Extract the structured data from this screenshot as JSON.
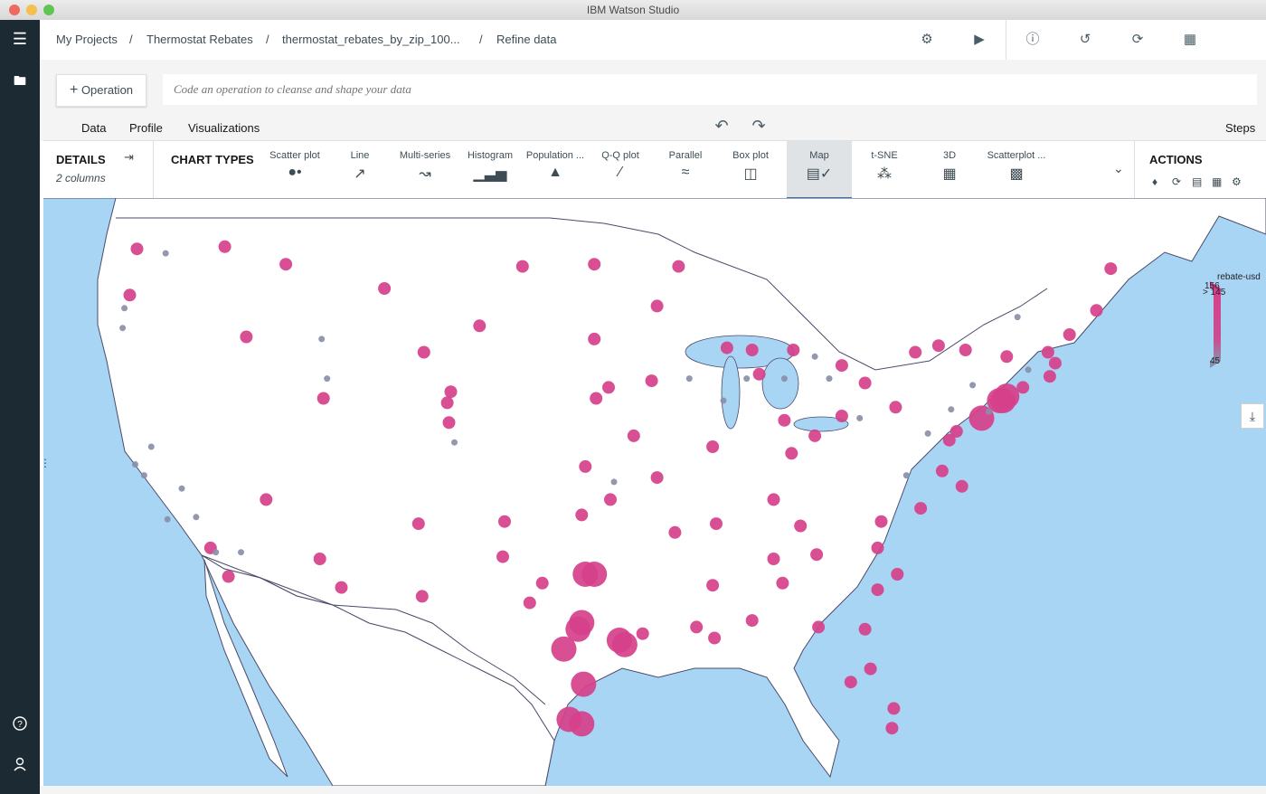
{
  "window": {
    "title": "IBM Watson Studio"
  },
  "breadcrumbs": [
    "My Projects",
    "Thermostat Rebates",
    "thermostat_rebates_by_zip_100...",
    "Refine data"
  ],
  "breadcrumb_separator": "/",
  "toolbar_icons": [
    "settings-icon",
    "run-icon",
    "info-icon",
    "history-icon",
    "refresh-icon",
    "grid-icon"
  ],
  "operation": {
    "button_label": "Operation",
    "input_placeholder": "Code an operation to cleanse and shape your data"
  },
  "tabs": [
    {
      "label": "Data",
      "active": false
    },
    {
      "label": "Profile",
      "active": false
    },
    {
      "label": "Visualizations",
      "active": true
    }
  ],
  "steps_label": "Steps",
  "details": {
    "label": "DETAILS",
    "columns": "2 columns"
  },
  "chart_types_label": "CHART TYPES",
  "chart_types": [
    {
      "label": "Scatter plot",
      "icon": "scatter-icon"
    },
    {
      "label": "Line",
      "icon": "line-icon"
    },
    {
      "label": "Multi-series",
      "icon": "multi-series-icon"
    },
    {
      "label": "Histogram",
      "icon": "histogram-icon"
    },
    {
      "label": "Population ...",
      "icon": "population-icon"
    },
    {
      "label": "Q-Q plot",
      "icon": "qq-icon"
    },
    {
      "label": "Parallel",
      "icon": "parallel-icon"
    },
    {
      "label": "Box plot",
      "icon": "boxplot-icon"
    },
    {
      "label": "Map",
      "icon": "map-icon",
      "active": true
    },
    {
      "label": "t-SNE",
      "icon": "tsne-icon"
    },
    {
      "label": "3D",
      "icon": "3d-icon"
    },
    {
      "label": "Scatterplot ...",
      "icon": "scatterplot-matrix-icon"
    }
  ],
  "actions_label": "ACTIONS",
  "legend": {
    "title": "rebate-usd",
    "max_label": "156",
    "cap_label": "> 145",
    "min_label": "45"
  },
  "colors": {
    "pink": "#d6408b",
    "gray": "#8a8fa8",
    "water": "#a9d5f5",
    "land": "#ffffff",
    "accent": "#3d70b2"
  },
  "map_points": [
    {
      "x": -122.3,
      "y": 47.6,
      "v": 150
    },
    {
      "x": -122.7,
      "y": 45.5,
      "v": 150
    },
    {
      "x": -121.9,
      "y": 37.3,
      "v": 60
    },
    {
      "x": -122.4,
      "y": 37.8,
      "v": 55
    },
    {
      "x": -121.5,
      "y": 38.6,
      "v": 60
    },
    {
      "x": -118.2,
      "y": 34.0,
      "v": 150
    },
    {
      "x": -117.2,
      "y": 32.7,
      "v": 140
    },
    {
      "x": -116.5,
      "y": 33.8,
      "v": 60
    },
    {
      "x": -112.1,
      "y": 33.5,
      "v": 150
    },
    {
      "x": -110.9,
      "y": 32.2,
      "v": 150
    },
    {
      "x": -115.1,
      "y": 36.2,
      "v": 150
    },
    {
      "x": -111.9,
      "y": 40.8,
      "v": 150
    },
    {
      "x": -116.2,
      "y": 43.6,
      "v": 150
    },
    {
      "x": -117.4,
      "y": 47.7,
      "v": 150
    },
    {
      "x": -114.0,
      "y": 46.9,
      "v": 150
    },
    {
      "x": -106.6,
      "y": 35.1,
      "v": 150
    },
    {
      "x": -104.9,
      "y": 39.7,
      "v": 150
    },
    {
      "x": -105.0,
      "y": 40.6,
      "v": 140
    },
    {
      "x": -106.4,
      "y": 31.8,
      "v": 150
    },
    {
      "x": -101.8,
      "y": 35.2,
      "v": 150
    },
    {
      "x": -101.9,
      "y": 33.6,
      "v": 150
    },
    {
      "x": -97.7,
      "y": 30.3,
      "v": 156
    },
    {
      "x": -97.5,
      "y": 30.6,
      "v": 156
    },
    {
      "x": -98.5,
      "y": 29.4,
      "v": 156
    },
    {
      "x": -96.8,
      "y": 32.8,
      "v": 156
    },
    {
      "x": -97.3,
      "y": 32.8,
      "v": 156
    },
    {
      "x": -95.4,
      "y": 29.8,
      "v": 156
    },
    {
      "x": -95.1,
      "y": 29.6,
      "v": 156
    },
    {
      "x": -97.4,
      "y": 27.8,
      "v": 156
    },
    {
      "x": -97.5,
      "y": 26.0,
      "v": 156
    },
    {
      "x": -98.2,
      "y": 26.2,
      "v": 156
    },
    {
      "x": -94.1,
      "y": 30.1,
      "v": 150
    },
    {
      "x": -99.7,
      "y": 32.4,
      "v": 150
    },
    {
      "x": -100.4,
      "y": 31.5,
      "v": 150
    },
    {
      "x": -97.5,
      "y": 35.5,
      "v": 150
    },
    {
      "x": -95.9,
      "y": 36.2,
      "v": 150
    },
    {
      "x": -94.6,
      "y": 39.1,
      "v": 150
    },
    {
      "x": -90.2,
      "y": 38.6,
      "v": 150
    },
    {
      "x": -93.3,
      "y": 37.2,
      "v": 150
    },
    {
      "x": -92.3,
      "y": 34.7,
      "v": 150
    },
    {
      "x": -90.0,
      "y": 35.1,
      "v": 150
    },
    {
      "x": -90.1,
      "y": 29.9,
      "v": 150
    },
    {
      "x": -91.1,
      "y": 30.4,
      "v": 150
    },
    {
      "x": -90.2,
      "y": 32.3,
      "v": 150
    },
    {
      "x": -86.8,
      "y": 33.5,
      "v": 150
    },
    {
      "x": -86.3,
      "y": 32.4,
      "v": 150
    },
    {
      "x": -88.0,
      "y": 30.7,
      "v": 150
    },
    {
      "x": -84.4,
      "y": 33.7,
      "v": 150
    },
    {
      "x": -81.7,
      "y": 30.3,
      "v": 150
    },
    {
      "x": -81.4,
      "y": 28.5,
      "v": 150
    },
    {
      "x": -82.5,
      "y": 27.9,
      "v": 150
    },
    {
      "x": -80.2,
      "y": 25.8,
      "v": 150
    },
    {
      "x": -80.1,
      "y": 26.7,
      "v": 150
    },
    {
      "x": -84.3,
      "y": 30.4,
      "v": 150
    },
    {
      "x": -81.0,
      "y": 32.1,
      "v": 150
    },
    {
      "x": -79.9,
      "y": 32.8,
      "v": 150
    },
    {
      "x": -81.0,
      "y": 34.0,
      "v": 150
    },
    {
      "x": -80.8,
      "y": 35.2,
      "v": 150
    },
    {
      "x": -78.6,
      "y": 35.8,
      "v": 150
    },
    {
      "x": -77.4,
      "y": 37.5,
      "v": 150
    },
    {
      "x": -76.3,
      "y": 36.8,
      "v": 150
    },
    {
      "x": -77.0,
      "y": 38.9,
      "v": 150
    },
    {
      "x": -76.6,
      "y": 39.3,
      "v": 150
    },
    {
      "x": -75.2,
      "y": 39.9,
      "v": 156
    },
    {
      "x": -74.0,
      "y": 40.7,
      "v": 156
    },
    {
      "x": -74.2,
      "y": 40.7,
      "v": 156
    },
    {
      "x": -73.8,
      "y": 40.9,
      "v": 156
    },
    {
      "x": -72.9,
      "y": 41.3,
      "v": 150
    },
    {
      "x": -71.4,
      "y": 41.8,
      "v": 150
    },
    {
      "x": -71.1,
      "y": 42.4,
      "v": 150
    },
    {
      "x": -71.5,
      "y": 42.9,
      "v": 150
    },
    {
      "x": -70.3,
      "y": 43.7,
      "v": 150
    },
    {
      "x": -68.8,
      "y": 44.8,
      "v": 150
    },
    {
      "x": -68.0,
      "y": 46.7,
      "v": 150
    },
    {
      "x": -73.8,
      "y": 42.7,
      "v": 150
    },
    {
      "x": -76.1,
      "y": 43.0,
      "v": 150
    },
    {
      "x": -77.6,
      "y": 43.2,
      "v": 150
    },
    {
      "x": -78.9,
      "y": 42.9,
      "v": 150
    },
    {
      "x": -80.0,
      "y": 40.4,
      "v": 150
    },
    {
      "x": -81.7,
      "y": 41.5,
      "v": 150
    },
    {
      "x": -83.0,
      "y": 40.0,
      "v": 150
    },
    {
      "x": -84.5,
      "y": 39.1,
      "v": 150
    },
    {
      "x": -83.0,
      "y": 42.3,
      "v": 150
    },
    {
      "x": -85.7,
      "y": 43.0,
      "v": 150
    },
    {
      "x": -86.2,
      "y": 39.8,
      "v": 150
    },
    {
      "x": -85.8,
      "y": 38.3,
      "v": 150
    },
    {
      "x": -86.8,
      "y": 36.2,
      "v": 150
    },
    {
      "x": -85.3,
      "y": 35.0,
      "v": 150
    },
    {
      "x": -87.6,
      "y": 41.9,
      "v": 150
    },
    {
      "x": -88.0,
      "y": 43.0,
      "v": 150
    },
    {
      "x": -89.4,
      "y": 43.1,
      "v": 150
    },
    {
      "x": -93.3,
      "y": 45.0,
      "v": 150
    },
    {
      "x": -92.1,
      "y": 46.8,
      "v": 150
    },
    {
      "x": -93.6,
      "y": 41.6,
      "v": 150
    },
    {
      "x": -96.0,
      "y": 41.3,
      "v": 150
    },
    {
      "x": -96.7,
      "y": 40.8,
      "v": 150
    },
    {
      "x": -97.3,
      "y": 37.7,
      "v": 150
    },
    {
      "x": -96.8,
      "y": 43.5,
      "v": 150
    },
    {
      "x": -96.8,
      "y": 46.9,
      "v": 150
    },
    {
      "x": -100.8,
      "y": 46.8,
      "v": 150
    },
    {
      "x": -103.2,
      "y": 44.1,
      "v": 150
    },
    {
      "x": -108.5,
      "y": 45.8,
      "v": 150
    },
    {
      "x": -106.3,
      "y": 42.9,
      "v": 150
    },
    {
      "x": -104.8,
      "y": 41.1,
      "v": 150
    },
    {
      "x": -123.0,
      "y": 44.9,
      "v": 60
    },
    {
      "x": -123.1,
      "y": 44.0,
      "v": 60
    },
    {
      "x": -120.7,
      "y": 47.4,
      "v": 60
    },
    {
      "x": -119.8,
      "y": 36.7,
      "v": 60
    },
    {
      "x": -119.0,
      "y": 35.4,
      "v": 60
    },
    {
      "x": -120.6,
      "y": 35.3,
      "v": 60
    },
    {
      "x": -117.9,
      "y": 33.8,
      "v": 60
    },
    {
      "x": -112.0,
      "y": 43.5,
      "v": 60
    },
    {
      "x": -111.7,
      "y": 41.7,
      "v": 60
    },
    {
      "x": -104.6,
      "y": 38.8,
      "v": 60
    },
    {
      "x": -88.3,
      "y": 41.7,
      "v": 60
    },
    {
      "x": -89.6,
      "y": 40.7,
      "v": 60
    },
    {
      "x": -86.2,
      "y": 41.7,
      "v": 60
    },
    {
      "x": -84.5,
      "y": 42.7,
      "v": 60
    },
    {
      "x": -83.7,
      "y": 41.7,
      "v": 60
    },
    {
      "x": -82.0,
      "y": 39.9,
      "v": 60
    },
    {
      "x": -91.5,
      "y": 41.7,
      "v": 60
    },
    {
      "x": -95.7,
      "y": 37.0,
      "v": 60
    },
    {
      "x": -74.8,
      "y": 40.2,
      "v": 60
    },
    {
      "x": -75.7,
      "y": 41.4,
      "v": 60
    },
    {
      "x": -76.9,
      "y": 40.3,
      "v": 60
    },
    {
      "x": -73.2,
      "y": 44.5,
      "v": 60
    },
    {
      "x": -72.6,
      "y": 42.1,
      "v": 60
    },
    {
      "x": -78.2,
      "y": 39.2,
      "v": 60
    },
    {
      "x": -79.4,
      "y": 37.3,
      "v": 60
    }
  ]
}
